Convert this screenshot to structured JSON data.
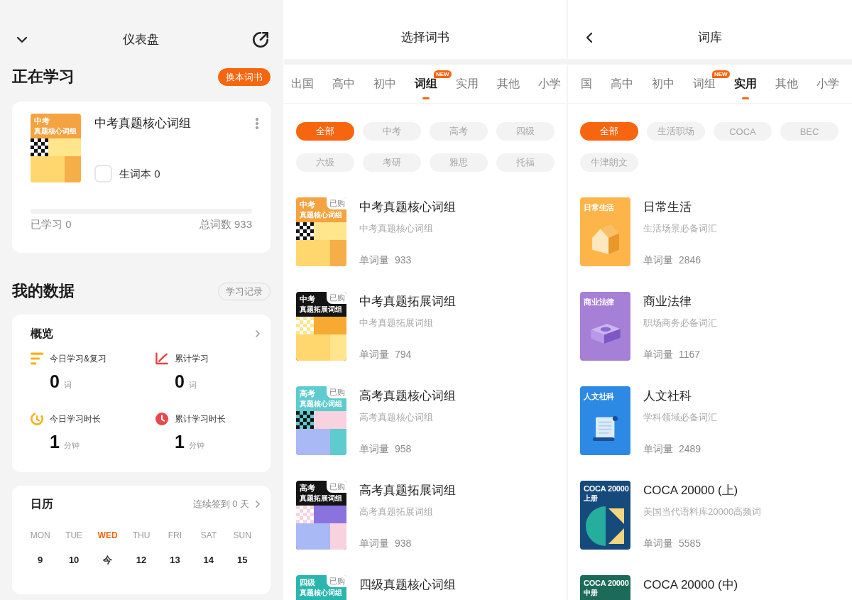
{
  "dashboard": {
    "title": "仪表盘",
    "current": {
      "heading": "正在学习",
      "button": "换本词书",
      "book": {
        "cover": {
          "kind": "banded",
          "title": "中考",
          "subtitle": "真题核心词组",
          "color": "#f5a340",
          "art": {
            "kind": "grid"
          }
        },
        "title": "中考真题核心词组",
        "notebook": {
          "label": "生词本 0",
          "checked": false
        },
        "progress": {
          "level": 0
        },
        "learned": "已学习 0",
        "total": "总词数 933"
      }
    },
    "my_data": {
      "heading": "我的数据",
      "button": "学习记录"
    },
    "overview": {
      "title": "概览",
      "stats": [
        {
          "kind": "lines",
          "label": "今日学习&复习",
          "value": "0",
          "unit": "词"
        },
        {
          "kind": "chart",
          "label": "累计学习",
          "value": "0",
          "unit": "词"
        },
        {
          "kind": "timer",
          "label": "今日学习时长",
          "value": "1",
          "unit": "分钟"
        },
        {
          "kind": "clock",
          "label": "累计学习时长",
          "value": "1",
          "unit": "分钟"
        }
      ]
    },
    "calendar": {
      "title": "日历",
      "streak": "连续签到 0 天",
      "days": [
        {
          "weekday": "MON",
          "date": "9",
          "selected": false
        },
        {
          "weekday": "TUE",
          "date": "10",
          "selected": false
        },
        {
          "weekday": "WED",
          "date": "今",
          "selected": true
        },
        {
          "weekday": "THU",
          "date": "12",
          "selected": false
        },
        {
          "weekday": "FRI",
          "date": "13",
          "selected": false
        },
        {
          "weekday": "SAT",
          "date": "14",
          "selected": false
        },
        {
          "weekday": "SUN",
          "date": "15",
          "selected": false
        }
      ]
    }
  },
  "book_picker": {
    "title": "选择词书",
    "tabs": [
      {
        "label": "出国",
        "selected": false
      },
      {
        "label": "高中",
        "selected": false
      },
      {
        "label": "初中",
        "selected": false
      },
      {
        "label": "词组",
        "badge": "NEW",
        "selected": true
      },
      {
        "label": "实用",
        "selected": false
      },
      {
        "label": "其他",
        "selected": false
      },
      {
        "label": "小学",
        "selected": false
      }
    ],
    "filters": [
      {
        "label": "全部",
        "selected": true
      },
      {
        "label": "中考",
        "selected": false
      },
      {
        "label": "高考",
        "selected": false
      },
      {
        "label": "四级",
        "selected": false
      },
      {
        "label": "六级",
        "selected": false
      },
      {
        "label": "考研",
        "selected": false
      },
      {
        "label": "雅思",
        "selected": false
      },
      {
        "label": "托福",
        "selected": false
      }
    ],
    "books": [
      {
        "cover": {
          "kind": "banded",
          "title": "中考",
          "subtitle": "真题核心词组",
          "color": "#f5a340",
          "art": {
            "kind": "grid"
          }
        },
        "tag": "已购",
        "title": "中考真题核心词组",
        "description": "中考真题核心词组",
        "count": "单词量 933"
      },
      {
        "cover": {
          "kind": "banded",
          "title": "中考",
          "subtitle": "真题拓展词组",
          "color": "#141414",
          "art": {
            "kind": "grid"
          }
        },
        "tag": "已购",
        "title": "中考真题拓展词组",
        "description": "中考真题拓展词组",
        "count": "单词量 794"
      },
      {
        "cover": {
          "kind": "banded",
          "title": "高考",
          "subtitle": "真题核心词组",
          "color": "#5ecbcf",
          "art": {
            "kind": "grid"
          }
        },
        "tag": "已购",
        "title": "高考真题核心词组",
        "description": "高考真题核心词组",
        "count": "单词量 958"
      },
      {
        "cover": {
          "kind": "banded",
          "title": "高考",
          "subtitle": "真题拓展词组",
          "color": "#141414",
          "art": {
            "kind": "grid"
          }
        },
        "tag": "已购",
        "title": "高考真题拓展词组",
        "description": "高考真题拓展词组",
        "count": "单词量 938"
      },
      {
        "cover": {
          "kind": "banded",
          "title": "四级",
          "subtitle": "真题核心词组",
          "color": "#2ab6ae"
        },
        "tag": "已购",
        "title": "四级真题核心词组"
      }
    ]
  },
  "word_bank": {
    "title": "词库",
    "back_button": true,
    "tabs": [
      {
        "label": "国",
        "selected": false
      },
      {
        "label": "高中",
        "selected": false
      },
      {
        "label": "初中",
        "selected": false
      },
      {
        "label": "词组",
        "badge": "NEW",
        "selected": false
      },
      {
        "label": "实用",
        "selected": true
      },
      {
        "label": "其他",
        "selected": false
      },
      {
        "label": "小学",
        "selected": false
      }
    ],
    "filters": [
      {
        "label": "全部",
        "selected": true
      },
      {
        "label": "生活职场",
        "selected": false
      },
      {
        "label": "COCA",
        "selected": false
      },
      {
        "label": "BEC",
        "selected": false
      },
      {
        "label": "牛津朗文",
        "selected": false
      }
    ],
    "books": [
      {
        "cover": {
          "kind": "plain",
          "title": "日常生活",
          "color": "#fdb549",
          "art": {
            "kind": "house"
          }
        },
        "title": "日常生活",
        "description": "生活场景必备词汇",
        "count": "单词量 2846"
      },
      {
        "cover": {
          "kind": "plain",
          "title": "商业法律",
          "color": "#a67fd7",
          "art": {
            "kind": "brick"
          }
        },
        "title": "商业法律",
        "description": "职场商务必备词汇",
        "count": "单词量 1167"
      },
      {
        "cover": {
          "kind": "plain",
          "title": "人文社科",
          "color": "#2c8ae4",
          "art": {
            "kind": "scroll"
          }
        },
        "title": "人文社科",
        "description": "学科领域必备词汇",
        "count": "单词量 2489"
      },
      {
        "cover": {
          "kind": "plain",
          "title": "COCA 20000",
          "subtitle": "上册",
          "color": "#164a7c",
          "art": {
            "kind": "shapes"
          }
        },
        "title": "COCA 20000 (上)",
        "description": "美国当代语料库20000高频词",
        "count": "单词量 5585"
      },
      {
        "cover": {
          "kind": "plain",
          "title": "COCA 20000",
          "subtitle": "中册",
          "color": "#1b6b58"
        },
        "title": "COCA 20000 (中)"
      }
    ]
  }
}
